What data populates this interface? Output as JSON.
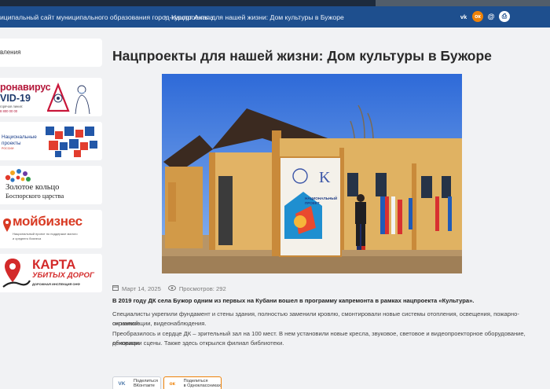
{
  "header": {
    "breadcrumb_site": "иципальный сайт муниципального образования город-курорт Анапа",
    "breadcrumb_sep": "›",
    "breadcrumb_current": "Нацпроекты для нашей жизни: Дом культуры в Бужоре",
    "icons": [
      "vk-icon",
      "odnoklassniki-icon",
      "email-icon",
      "print-icon"
    ],
    "icon_labels": {
      "vk": "vk",
      "ok": "ок",
      "email": "@",
      "print": "⎙"
    }
  },
  "sidebar": {
    "menu_label": "вления",
    "banners": {
      "covid": {
        "line1": "ронавирус",
        "line2": "VID-19",
        "line3": "горячая линия:",
        "line4": "8 800 00 00"
      },
      "natproject": {
        "line1": "Национальные",
        "line2": "проекты",
        "line3": "РОССИИ"
      },
      "golden_ring": {
        "line1": "Золотое кольцо",
        "line2": "Боспорского царства"
      },
      "business": {
        "line1": "мойбизнес",
        "line2": "Национальный проект по поддержке малого",
        "line3": "и среднего бизнеса"
      },
      "map": {
        "line1": "КАРТА",
        "line2": "УБИТЫХ ДОРОГ",
        "line3": "ДОРОЖНАЯ ИНСПЕКЦИЯ ОНФ"
      }
    }
  },
  "article": {
    "title": "Нацпроекты для нашей жизни: Дом культуры в Бужоре",
    "date": "Март 14, 2025",
    "views": "Просмотров: 292",
    "lead": "В 2019 году ДК села Бужор одним из первых на Кубани вошел в программу капремонта в рамках нацпроекта «Культура».",
    "p1_a": "Специалисты укрепили фундамент и стены здания, полностью заменили кровлю, смонтировали новые системы отопления, освещения, пожарно-охранной",
    "p1_b": "сигнализации, видеонаблюдения.",
    "p2_a": "Преобразилось и сердце ДК – зрительный зал на 100 мест. В нем установили новые кресла, звуковое, световое и видеопроекторное оборудование, обновили",
    "p2_b": "декорации сцены. Также здесь открылся филиал библиотеки.",
    "photo_sign": {
      "line1": "НАЦИОНАЛЬНЫЙ",
      "line2": "ПРОЕКТ"
    }
  },
  "share": {
    "vk": {
      "logo": "VK",
      "line1": "Поделиться",
      "line2": "ВКонтакте"
    },
    "ok": {
      "logo": "ок",
      "line1": "Поделиться",
      "line2": "в Одноклассниках"
    }
  },
  "colors": {
    "nav": "#1e4f8e",
    "topbar": "#1d2b3d",
    "ok": "#ee8208",
    "background": "#f1f2f4"
  }
}
